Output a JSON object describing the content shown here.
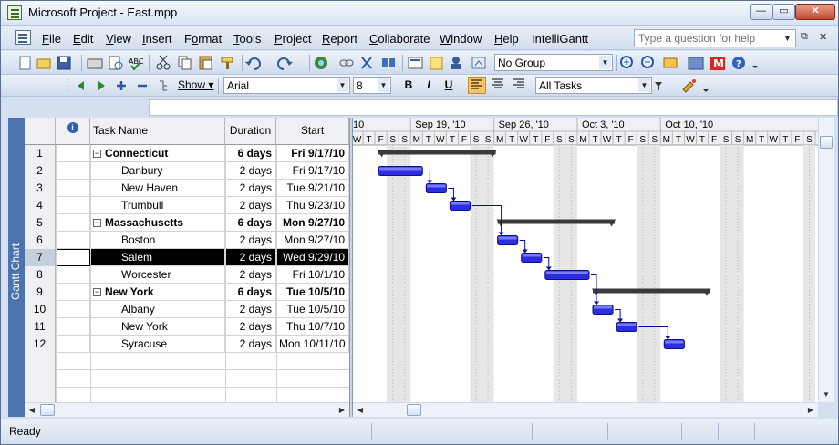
{
  "window": {
    "title": "Microsoft Project - East.mpp"
  },
  "menu": [
    {
      "label": "File",
      "u": "F",
      "rest": "ile"
    },
    {
      "label": "Edit",
      "u": "E",
      "rest": "dit"
    },
    {
      "label": "View",
      "u": "V",
      "rest": "iew"
    },
    {
      "label": "Insert",
      "u": "I",
      "rest": "nsert"
    },
    {
      "label": "Format",
      "u": "o",
      "pre": "F",
      "rest": "rmat"
    },
    {
      "label": "Tools",
      "u": "T",
      "rest": "ools"
    },
    {
      "label": "Project",
      "u": "P",
      "rest": "roject"
    },
    {
      "label": "Report",
      "u": "R",
      "rest": "eport"
    },
    {
      "label": "Collaborate",
      "u": "C",
      "rest": "ollaborate"
    },
    {
      "label": "Window",
      "u": "W",
      "rest": "indow"
    },
    {
      "label": "Help",
      "u": "H",
      "rest": "elp"
    },
    {
      "label": "IntelliGantt",
      "u": "",
      "rest": "IntelliGantt"
    }
  ],
  "help_box": {
    "placeholder": "Type a question for help"
  },
  "toolbar": {
    "group_combo": "No Group",
    "show_label": "Show",
    "font_combo": "Arial",
    "size_combo": "8",
    "filter_combo": "All Tasks",
    "bold": "B",
    "italic": "I",
    "underline": "U"
  },
  "view_bar_label": "Gantt Chart",
  "table": {
    "headers": {
      "indicator": "i",
      "task_name": "Task Name",
      "duration": "Duration",
      "start": "Start"
    },
    "rows": [
      {
        "id": "1",
        "name": "Connecticut",
        "duration": "6 days",
        "start": "Fri 9/17/10",
        "summary": true
      },
      {
        "id": "2",
        "name": "Danbury",
        "duration": "2 days",
        "start": "Fri 9/17/10",
        "summary": false
      },
      {
        "id": "3",
        "name": "New Haven",
        "duration": "2 days",
        "start": "Tue 9/21/10",
        "summary": false
      },
      {
        "id": "4",
        "name": "Trumbull",
        "duration": "2 days",
        "start": "Thu 9/23/10",
        "summary": false
      },
      {
        "id": "5",
        "name": "Massachusetts",
        "duration": "6 days",
        "start": "Mon 9/27/10",
        "summary": true
      },
      {
        "id": "6",
        "name": "Boston",
        "duration": "2 days",
        "start": "Mon 9/27/10",
        "summary": false
      },
      {
        "id": "7",
        "name": "Salem",
        "duration": "2 days",
        "start": "Wed 9/29/10",
        "summary": false,
        "selected": true
      },
      {
        "id": "8",
        "name": "Worcester",
        "duration": "2 days",
        "start": "Fri 10/1/10",
        "summary": false
      },
      {
        "id": "9",
        "name": "New York",
        "duration": "6 days",
        "start": "Tue 10/5/10",
        "summary": true
      },
      {
        "id": "10",
        "name": "Albany",
        "duration": "2 days",
        "start": "Tue 10/5/10",
        "summary": false
      },
      {
        "id": "11",
        "name": "New York",
        "duration": "2 days",
        "start": "Thu 10/7/10",
        "summary": false
      },
      {
        "id": "12",
        "name": "Syracuse",
        "duration": "2 days",
        "start": "Mon 10/11/10",
        "summary": false
      }
    ]
  },
  "timescale": {
    "weeks": [
      "10",
      "Sep 19, '10",
      "Sep 26, '10",
      "Oct 3, '10",
      "Oct 10, '10"
    ],
    "days": [
      "W",
      "T",
      "F",
      "S",
      "S",
      "M",
      "T",
      "W",
      "T",
      "F",
      "S",
      "S",
      "M",
      "T",
      "W",
      "T",
      "F",
      "S",
      "S",
      "M",
      "T",
      "W",
      "T",
      "F",
      "S",
      "S",
      "M",
      "T",
      "W",
      "T",
      "F",
      "S",
      "S",
      "M",
      "T",
      "W",
      "T",
      "F",
      "S"
    ]
  },
  "gantt_tasks": [
    {
      "row": 0,
      "start": 2,
      "days": 10,
      "summary": true
    },
    {
      "row": 1,
      "start": 2,
      "days": 4,
      "summary": false
    },
    {
      "row": 2,
      "start": 6,
      "days": 2,
      "summary": false
    },
    {
      "row": 3,
      "start": 8,
      "days": 2,
      "summary": false
    },
    {
      "row": 4,
      "start": 12,
      "days": 10,
      "summary": true
    },
    {
      "row": 5,
      "start": 12,
      "days": 2,
      "summary": false
    },
    {
      "row": 6,
      "start": 14,
      "days": 2,
      "summary": false
    },
    {
      "row": 7,
      "start": 16,
      "days": 4,
      "summary": false
    },
    {
      "row": 8,
      "start": 20,
      "days": 10,
      "summary": true
    },
    {
      "row": 9,
      "start": 20,
      "days": 2,
      "summary": false
    },
    {
      "row": 10,
      "start": 22,
      "days": 2,
      "summary": false
    },
    {
      "row": 11,
      "start": 26,
      "days": 2,
      "summary": false
    }
  ],
  "colors": {
    "bar": "#2a2ee0",
    "summary": "#3a3a3a",
    "nonworking": "#e6e6e6",
    "accent": "#4c72b0"
  },
  "status": {
    "text": "Ready"
  }
}
